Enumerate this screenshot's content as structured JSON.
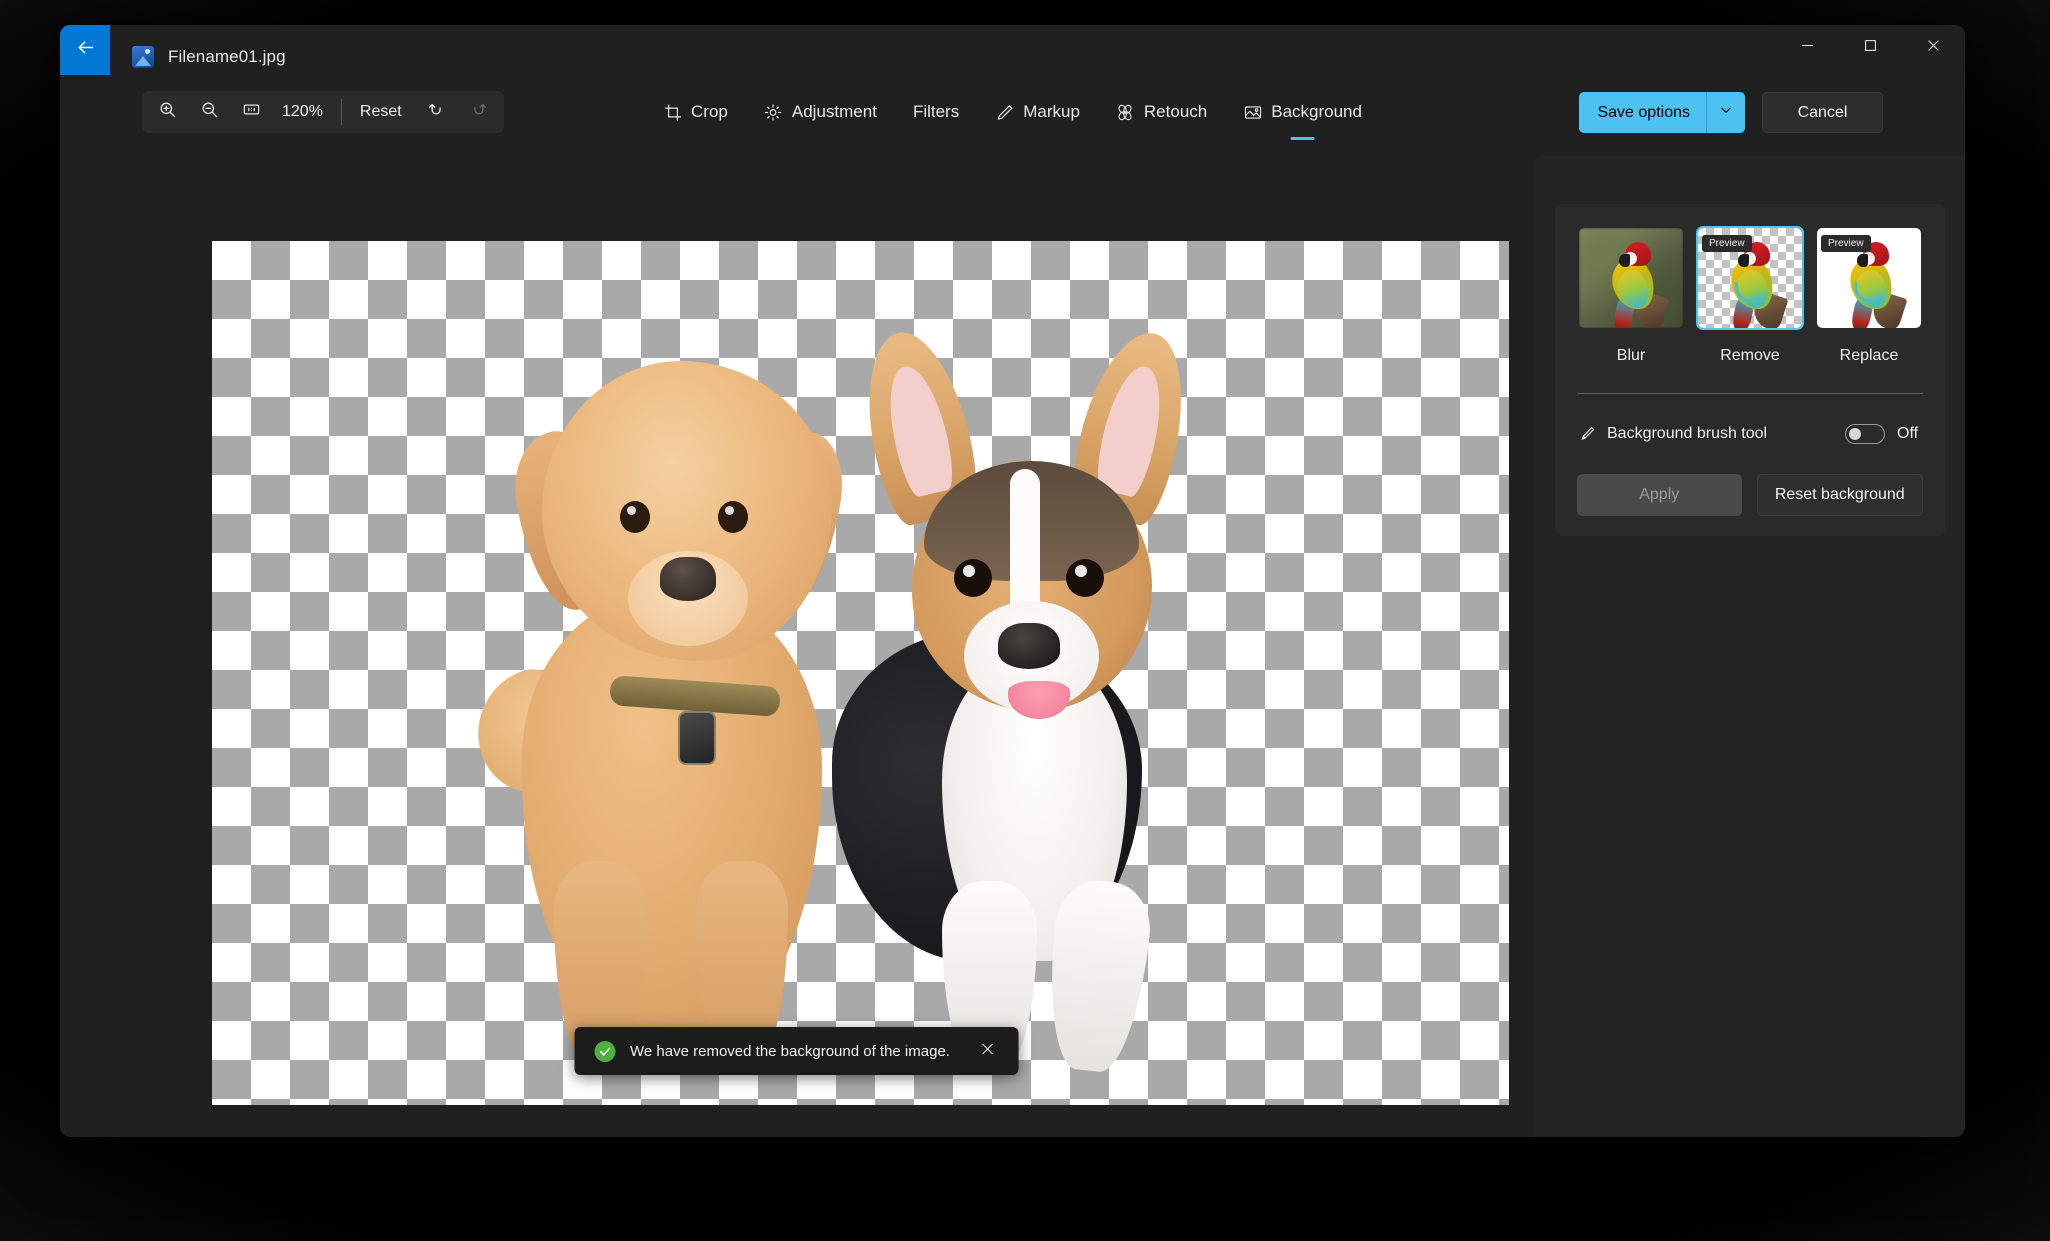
{
  "window": {
    "file_name": "Filename01.jpg",
    "back_icon": "arrow-left-icon",
    "file_type_icon": "image-file-icon",
    "controls": {
      "minimize": "minimize-icon",
      "maximize": "maximize-icon",
      "close": "close-icon"
    }
  },
  "zoom_bar": {
    "zoom_in_icon": "zoom-in-icon",
    "zoom_out_icon": "zoom-out-icon",
    "actual_size_icon": "1:1",
    "zoom_level": "120%",
    "reset_label": "Reset",
    "undo_icon": "undo-icon",
    "redo_icon": "redo-icon",
    "redo_disabled": true
  },
  "tabs": [
    {
      "label": "Crop",
      "icon": "crop-icon",
      "active": false
    },
    {
      "label": "Adjustment",
      "icon": "brightness-icon",
      "active": false
    },
    {
      "label": "Filters",
      "icon": "",
      "active": false
    },
    {
      "label": "Markup",
      "icon": "pencil-icon",
      "active": false
    },
    {
      "label": "Retouch",
      "icon": "retouch-icon",
      "active": false
    },
    {
      "label": "Background",
      "icon": "background-icon",
      "active": true
    }
  ],
  "top_actions": {
    "save_options_label": "Save options",
    "save_options_chevron": "chevron-down-icon",
    "cancel_label": "Cancel"
  },
  "canvas": {
    "transparency": "checkerboard",
    "subject": "two puppies on transparent background"
  },
  "toast": {
    "icon": "success-check-icon",
    "message": "We have removed the background of the image.",
    "close_icon": "close-icon"
  },
  "panel": {
    "background_options": [
      {
        "label": "Blur",
        "preview_badge": "",
        "selected": false,
        "thumb": "blurred-photo"
      },
      {
        "label": "Remove",
        "preview_badge": "Preview",
        "selected": true,
        "thumb": "transparent-checkerboard"
      },
      {
        "label": "Replace",
        "preview_badge": "Preview",
        "selected": false,
        "thumb": "white-background"
      }
    ],
    "brush": {
      "icon": "brush-icon",
      "label": "Background brush tool",
      "state": "Off"
    },
    "apply_label": "Apply",
    "apply_disabled": true,
    "reset_background_label": "Reset background"
  },
  "colors": {
    "accent": "#4cc2f1",
    "back_button": "#0078d4",
    "window_bg": "#202020",
    "panel_bg": "#242424",
    "card_bg": "#2a2a2a",
    "success": "#4caf3f",
    "checker_gray": "#a9a9a9"
  }
}
